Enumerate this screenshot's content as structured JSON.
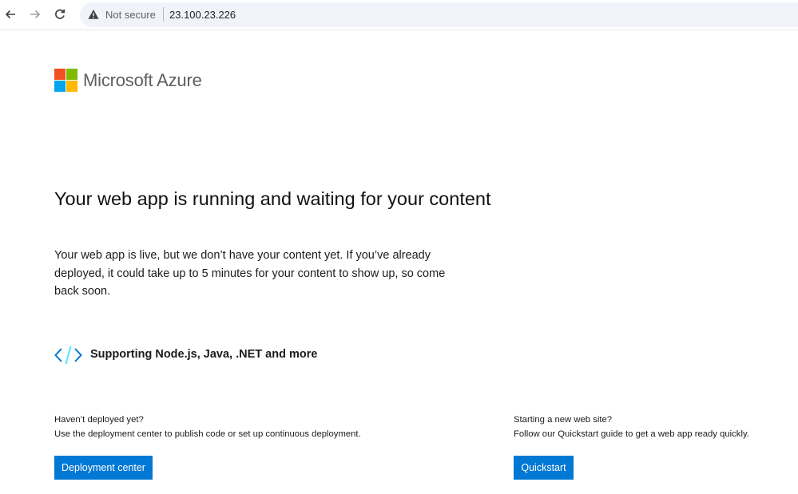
{
  "browser": {
    "security_label": "Not secure",
    "url": "23.100.23.226"
  },
  "brand": {
    "name": "Microsoft Azure",
    "colors": [
      "#f25022",
      "#7fba00",
      "#00a4ef",
      "#ffb900"
    ]
  },
  "main": {
    "headline": "Your web app is running and waiting for your content",
    "description": "Your web app is live, but we don’t have your content yet. If you’ve already deployed, it could take up to 5 minutes for your content to show up, so come back soon.",
    "support_text": "Supporting Node.js, Java, .NET and more",
    "support_icon": "code-icon"
  },
  "deploy": {
    "question": "Haven’t deployed yet?",
    "detail": "Use the deployment center to publish code or set up continuous deployment.",
    "button_label": "Deployment center"
  },
  "quickstart": {
    "question": "Starting a new web site?",
    "detail": "Follow our Quickstart guide to get a web app ready quickly.",
    "button_label": "Quickstart"
  },
  "accent_color": "#0078d4"
}
